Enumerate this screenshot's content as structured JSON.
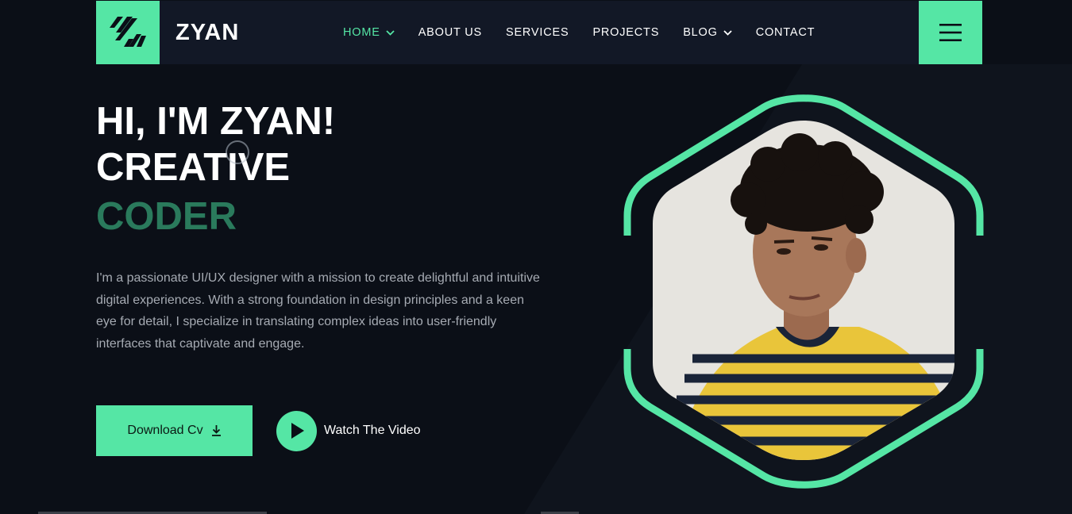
{
  "header": {
    "brand": "ZYAN",
    "logo_icon": "slash-lines-logo-icon",
    "menu_icon": "hamburger-menu-icon",
    "nav": [
      {
        "label": "HOME",
        "has_dropdown": true,
        "active": true
      },
      {
        "label": "ABOUT US",
        "has_dropdown": false,
        "active": false
      },
      {
        "label": "SERVICES",
        "has_dropdown": false,
        "active": false
      },
      {
        "label": "PROJECTS",
        "has_dropdown": false,
        "active": false
      },
      {
        "label": "BLOG",
        "has_dropdown": true,
        "active": false
      },
      {
        "label": "CONTACT",
        "has_dropdown": false,
        "active": false
      }
    ]
  },
  "hero": {
    "line1": "HI, I'M ZYAN!",
    "line2": "CREATIVE",
    "line3": "CODER",
    "description": "I'm a passionate UI/UX designer with a mission to create delightful and intuitive digital experiences. With a strong foundation in design principles and a keen eye for detail, I specialize in translating complex ideas into user-friendly interfaces that captivate and engage.",
    "download_label": "Download Cv",
    "download_icon": "download-icon",
    "video_label": "Watch The Video",
    "video_icon": "play-icon"
  },
  "colors": {
    "accent": "#55e6a5",
    "background": "#0b0f17",
    "header_bg": "#121826",
    "coder_text": "#2a7a5c",
    "body_text": "#a6abb3"
  }
}
